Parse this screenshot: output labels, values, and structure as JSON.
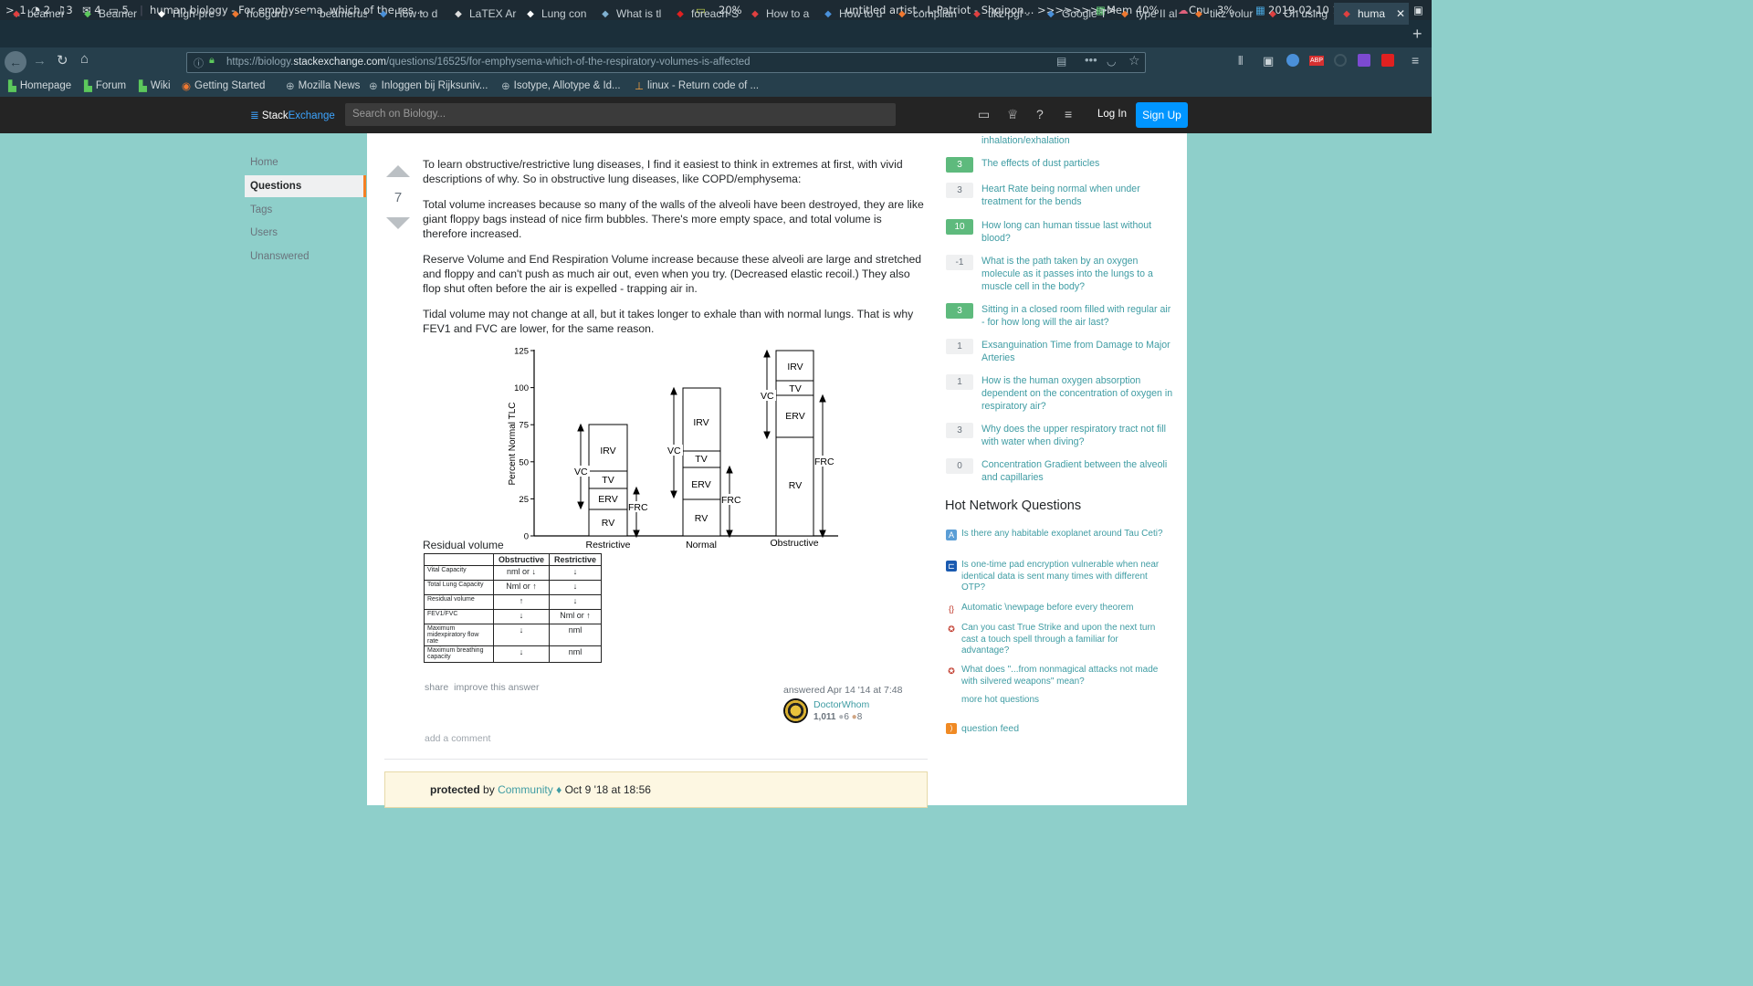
{
  "system_bar": {
    "workspaces": [
      ">_1",
      "2",
      "3",
      "4",
      "5"
    ],
    "window_title": "human biology - For emphysema, which of the res...",
    "battery": "20%",
    "music": "untitled artist - L-Patriot - Shqipon... >>>>>>>>>",
    "mem": "Mem 40%",
    "cpu_label": "Cpu",
    "cpu": "3%",
    "datetime": "2019-02-10  19:17"
  },
  "tabs": [
    "beamer",
    "Beamer",
    "High-pre",
    "hoogdru",
    "beameruser",
    "How to d",
    "LaTEX Ar",
    "Lung con",
    "What is tl",
    "foreach-S",
    "How to a",
    "How to u",
    "complian",
    "tikz pgf -",
    "Google T",
    "type II al",
    "tikz volur",
    "On using",
    "huma"
  ],
  "url": {
    "prefix": "https://biology.",
    "domain": "stackexchange.com",
    "path": "/questions/16525/for-emphysema-which-of-the-respiratory-volumes-is-affected"
  },
  "bookmarks": [
    "Homepage",
    "Forum",
    "Wiki",
    "Getting Started",
    "Mozilla News",
    "Inloggen bij Rijksuniv...",
    "Isotype, Allotype & Id...",
    "linux - Return code of ..."
  ],
  "se_header": {
    "brand_a": "Stack",
    "brand_b": "Exchange",
    "search_placeholder": "Search on Biology...",
    "login": "Log In",
    "signup": "Sign Up"
  },
  "left_nav": [
    "Home",
    "Questions",
    "Tags",
    "Users",
    "Unanswered"
  ],
  "answer": {
    "votes": "7",
    "paragraphs": [
      "To learn obstructive/restrictive lung diseases, I find it easiest to think in extremes at first, with vivid descriptions of why. So in obstructive lung diseases, like COPD/emphysema:",
      "Total volume increases because so many of the walls of the alveoli have been destroyed, they are like giant floppy bags instead of nice firm bubbles. There's more empty space, and total volume is therefore increased.",
      "Reserve Volume and End Respiration Volume increase because these alveoli are large and stretched and floppy and can't push as much air out, even when you try. (Decreased elastic recoil.) They also flop shut often before the air is expelled - trapping air in.",
      "Tidal volume may not change at all, but it takes longer to exhale than with normal lungs. That is why FEV1 and FVC are lower, for the same reason."
    ],
    "image_caption": "Residual volume",
    "share": "share",
    "improve": "improve this answer",
    "answered": "answered Apr 14 '14 at 7:48",
    "user_name": "DoctorWhom",
    "user_rep": "1,011",
    "silver": "6",
    "bronze": "8",
    "add_comment": "add a comment",
    "protected_label": "protected",
    "protected_by": "by",
    "protected_user": "Community",
    "protected_date": "Oct 9 '18 at 18:56"
  },
  "figure": {
    "ylabel": "Percent Normal TLC",
    "yticks": [
      "125",
      "100",
      "75",
      "50",
      "25",
      "0"
    ],
    "columns": [
      {
        "label": "Restrictive",
        "segments": [
          "IRV",
          "TV",
          "ERV",
          "RV"
        ]
      },
      {
        "label": "Normal",
        "segments": [
          "IRV",
          "TV",
          "ERV",
          "RV"
        ]
      },
      {
        "label": "Obstructive",
        "segments": [
          "IRV",
          "TV",
          "ERV",
          "RV"
        ]
      }
    ],
    "vc": "VC",
    "frc": "FRC"
  },
  "table": {
    "headers": [
      "",
      "Obstructive",
      "Restrictive"
    ],
    "rows": [
      [
        "Vital Capacity",
        "nml or ↓",
        "↓"
      ],
      [
        "Total Lung Capacity",
        "Nml or ↑",
        "↓"
      ],
      [
        "Residual volume",
        "↑",
        "↓"
      ],
      [
        "FEV1/FVC",
        "↓",
        "Nml or ↑"
      ],
      [
        "Maximum midexpiratory flow rate",
        "↓",
        "nml"
      ],
      [
        "Maximum breathing capacity",
        "↓",
        "nml"
      ]
    ]
  },
  "sidebar": {
    "top_fragment": "inhalation/exhalation",
    "related": [
      {
        "score": "3",
        "title": "The effects of dust particles",
        "accepted": true
      },
      {
        "score": "3",
        "title": "Heart Rate being normal when under treatment for the bends",
        "accepted": false
      },
      {
        "score": "10",
        "title": "How long can human tissue last without blood?",
        "accepted": true
      },
      {
        "score": "-1",
        "title": "What is the path taken by an oxygen molecule as it passes into the lungs to a muscle cell in the body?",
        "accepted": false
      },
      {
        "score": "3",
        "title": "Sitting in a closed room filled with regular air - for how long will the air last?",
        "accepted": true
      },
      {
        "score": "1",
        "title": "Exsanguination Time from Damage to Major Arteries",
        "accepted": false
      },
      {
        "score": "1",
        "title": "How is the human oxygen absorption dependent on the concentration of oxygen in respiratory air?",
        "accepted": false
      },
      {
        "score": "3",
        "title": "Why does the upper respiratory tract not fill with water when diving?",
        "accepted": false
      },
      {
        "score": "0",
        "title": "Concentration Gradient between the alveoli and capillaries",
        "accepted": false
      }
    ],
    "hot_title": "Hot Network Questions",
    "hot": [
      "Is there any habitable exoplanet around Tau Ceti?",
      "Is one-time pad encryption vulnerable when near identical data is sent many times with different OTP?",
      "Automatic \\newpage before every theorem",
      "Can you cast True Strike and upon the next turn cast a touch spell through a familiar for advantage?",
      "What does \"...from nonmagical attacks not made with silvered weapons\" mean?"
    ],
    "more_hot": "more hot questions",
    "feed": "question feed"
  }
}
